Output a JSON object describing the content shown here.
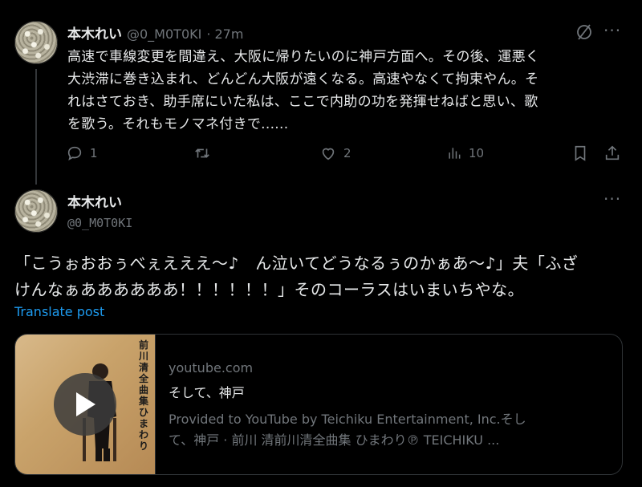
{
  "tweet1": {
    "author_name": "本木れい",
    "author_handle": "@0_M0T0KI",
    "time": "· 27m",
    "text_lines": [
      "高速で車線変更を間違え、大阪に帰りたいのに神戸方面へ。その後、運悪く",
      "大渋滞に巻き込まれ、どんどん大阪が遠くなる。高速やなくて拘束やん。そ",
      "れはさておき、助手席にいた私は、ここで内助の功を発揮せねばと思い、歌",
      "を歌う。それもモノマネ付きで......"
    ],
    "replies": "1",
    "likes": "2",
    "views": "10"
  },
  "tweet2": {
    "author_name": "本木れい",
    "author_handle": "@0_M0T0KI",
    "text_lines": [
      "「こうぉおおぅべぇえええ〜♪　ん泣いてどうなるぅのかぁあ〜♪」夫「ふざ",
      "けんなぁああああああ！！！！！！」そのコーラスはいまいちやな。"
    ],
    "translate_label": "Translate post",
    "card": {
      "domain": "youtube.com",
      "title": "そして、神戸",
      "description_lines": [
        "Provided to YouTube by Teichiku Entertainment, Inc.そし",
        "て、神戸 · 前川 清前川清全曲集 ひまわり℗ TEICHIKU ..."
      ],
      "album_text": "前川清全曲集 ひまわり"
    }
  },
  "colors": {
    "background": "#000000",
    "text": "#e7e9ea",
    "muted": "#71767b",
    "link": "#1d9bf0",
    "border": "#2f3336"
  }
}
